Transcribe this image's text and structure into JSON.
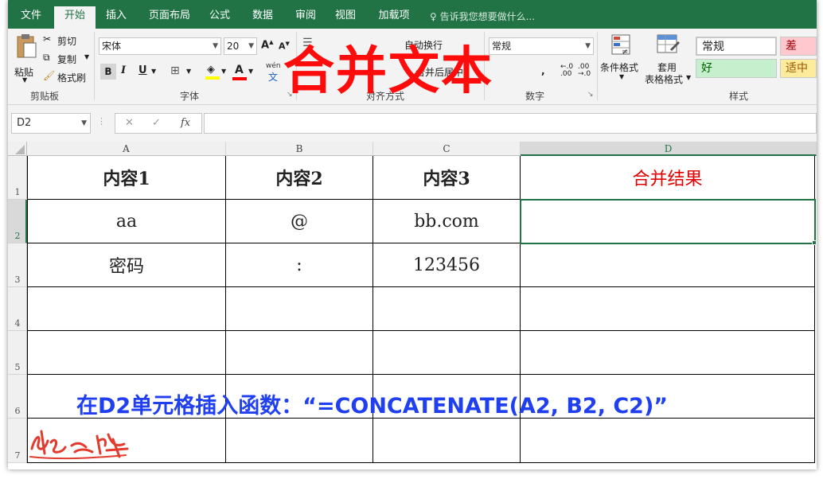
{
  "tabs": [
    "文件",
    "开始",
    "插入",
    "页面布局",
    "公式",
    "数据",
    "审阅",
    "视图",
    "加载项"
  ],
  "tell_me": "告诉我您想要做什么...",
  "clipboard": {
    "paste": "粘贴",
    "cut": "剪切",
    "copy": "复制",
    "format_painter": "格式刷",
    "label": "剪贴板"
  },
  "font": {
    "name": "宋体",
    "size": "20",
    "grow": "A",
    "shrink": "A",
    "bold": "B",
    "italic": "I",
    "underline": "U",
    "wen": "wén",
    "wen_char": "文",
    "label": "字体",
    "font_color": "#ff0000",
    "fill_color": "#ffff00"
  },
  "alignment": {
    "wrap": "自动换行",
    "merge": "合并后居中",
    "label": "对齐方式"
  },
  "number": {
    "format": "常规",
    "label": "数字"
  },
  "styles": {
    "cond_format": "条件格式",
    "table_format_1": "套用",
    "table_format_2": "表格格式",
    "normal": "常规",
    "bad": "差",
    "good": "好",
    "neutral": "适中",
    "label": "样式"
  },
  "overlay_title": "合并文本",
  "formula_bar": {
    "name_box": "D2",
    "cancel": "✕",
    "enter": "✓",
    "fx": "fx",
    "value": ""
  },
  "columns": [
    "A",
    "B",
    "C",
    "D"
  ],
  "rows": [
    "1",
    "2",
    "3",
    "4",
    "5",
    "6",
    "7"
  ],
  "cells": {
    "A1": "内容1",
    "B1": "内容2",
    "C1": "内容3",
    "D1": "合并结果",
    "A2": "aa",
    "B2": "@",
    "C2": "bb.com",
    "D2": "",
    "A3": "密码",
    "B3": ":",
    "C3": "123456",
    "D3": ""
  },
  "caption": "在D2单元格插入函数：“=CONCATENATE(A2, B2, C2)”",
  "colors": {
    "excel_green": "#217346",
    "title_red": "#ff0b0b",
    "caption_blue": "#1f3ff0",
    "header_red": "#e00000"
  }
}
